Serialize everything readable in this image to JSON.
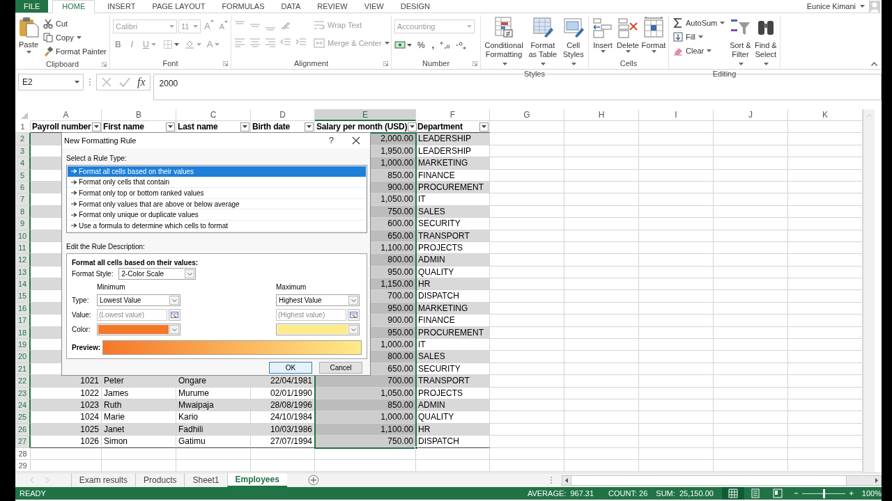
{
  "ribbon_tabs": [
    {
      "label": "FILE",
      "kind": "file",
      "selected": false
    },
    {
      "label": "HOME",
      "kind": "tab",
      "selected": true
    },
    {
      "label": "INSERT",
      "kind": "tab",
      "selected": false
    },
    {
      "label": "PAGE LAYOUT",
      "kind": "tab",
      "selected": false
    },
    {
      "label": "FORMULAS",
      "kind": "tab",
      "selected": false
    },
    {
      "label": "DATA",
      "kind": "tab",
      "selected": false
    },
    {
      "label": "REVIEW",
      "kind": "tab",
      "selected": false
    },
    {
      "label": "VIEW",
      "kind": "tab",
      "selected": false
    },
    {
      "label": "DESIGN",
      "kind": "tab",
      "selected": false
    }
  ],
  "user": {
    "name": "Eunice Kimani"
  },
  "ribbon": {
    "clipboard": {
      "label": "Clipboard",
      "paste": "Paste",
      "cut": "Cut",
      "copy": "Copy",
      "format_painter": "Format Painter"
    },
    "font": {
      "label": "Font",
      "disabled": true,
      "name": "Calibri",
      "size": "11",
      "grow": "A",
      "shrink": "A",
      "bold": "B",
      "italic": "I",
      "underline": "U",
      "font_color": "A"
    },
    "alignment": {
      "label": "Alignment",
      "disabled": true,
      "wrap_text": "Wrap Text",
      "merge_center": "Merge & Center"
    },
    "number": {
      "label": "Number",
      "format": "Accounting",
      "format_disabled": true,
      "percent": "%",
      "comma": ","
    },
    "styles": {
      "label": "Styles",
      "buttons": [
        "Conditional Formatting",
        "Format as Table",
        "Cell Styles"
      ]
    },
    "cells": {
      "label": "Cells",
      "buttons": [
        "Insert",
        "Delete",
        "Format"
      ]
    },
    "editing": {
      "label": "Editing",
      "autosum": "AutoSum",
      "fill": "Fill",
      "clear": "Clear",
      "sort_filter": "Sort & Filter",
      "find_select": "Find & Select"
    }
  },
  "formula_bar": {
    "name_box": "E2",
    "fx": "fx",
    "formula": "2000"
  },
  "table": {
    "columns": [
      {
        "letter": "A",
        "selected": false
      },
      {
        "letter": "B",
        "selected": false
      },
      {
        "letter": "C",
        "selected": false
      },
      {
        "letter": "D",
        "selected": false
      },
      {
        "letter": "E",
        "selected": true
      },
      {
        "letter": "F",
        "selected": false
      },
      {
        "letter": "G",
        "selected": false
      },
      {
        "letter": "H",
        "selected": false
      },
      {
        "letter": "I",
        "selected": false
      },
      {
        "letter": "J",
        "selected": false
      },
      {
        "letter": "K",
        "selected": false
      }
    ],
    "header_row": {
      "number": "1",
      "selected": false,
      "cells": [
        "Payroll number",
        "First name",
        "Last name",
        "Birth date",
        "Salary per month (USD)",
        "Department"
      ]
    },
    "rows": [
      {
        "number": "2",
        "selected": true,
        "salary": "2,000.00",
        "department": "LEADERSHIP"
      },
      {
        "number": "3",
        "selected": true,
        "salary": "1,950.00",
        "department": "LEADERSHIP"
      },
      {
        "number": "4",
        "selected": true,
        "salary": "1,000.00",
        "department": "MARKETING"
      },
      {
        "number": "5",
        "selected": true,
        "salary": "850.00",
        "department": "FINANCE"
      },
      {
        "number": "6",
        "selected": true,
        "salary": "900.00",
        "department": "PROCUREMENT"
      },
      {
        "number": "7",
        "selected": true,
        "salary": "1,050.00",
        "department": "IT"
      },
      {
        "number": "8",
        "selected": true,
        "salary": "750.00",
        "department": "SALES"
      },
      {
        "number": "9",
        "selected": true,
        "salary": "600.00",
        "department": "SECURITY"
      },
      {
        "number": "10",
        "selected": true,
        "salary": "650.00",
        "department": "TRANSPORT"
      },
      {
        "number": "11",
        "selected": true,
        "salary": "1,100.00",
        "department": "PROJECTS"
      },
      {
        "number": "12",
        "selected": true,
        "salary": "800.00",
        "department": "ADMIN"
      },
      {
        "number": "13",
        "selected": true,
        "salary": "950.00",
        "department": "QUALITY"
      },
      {
        "number": "14",
        "selected": true,
        "salary": "1,150.00",
        "department": "HR"
      },
      {
        "number": "15",
        "selected": true,
        "salary": "700.00",
        "department": "DISPATCH"
      },
      {
        "number": "16",
        "selected": true,
        "salary": "950.00",
        "department": "MARKETING"
      },
      {
        "number": "17",
        "selected": true,
        "salary": "900.00",
        "department": "FINANCE"
      },
      {
        "number": "18",
        "selected": true,
        "salary": "950.00",
        "department": "PROCUREMENT"
      },
      {
        "number": "19",
        "selected": true,
        "salary": "1,000.00",
        "department": "IT"
      },
      {
        "number": "20",
        "selected": true,
        "salary": "800.00",
        "department": "SALES"
      },
      {
        "number": "21",
        "selected": true,
        "salary": "650.00",
        "department": "SECURITY"
      },
      {
        "number": "22",
        "selected": true,
        "payroll": "1021",
        "first_name": "Peter",
        "last_name": "Ongare",
        "birth_date": "22/04/1981",
        "salary": "700.00",
        "department": "TRANSPORT"
      },
      {
        "number": "23",
        "selected": true,
        "payroll": "1022",
        "first_name": "James",
        "last_name": "Murume",
        "birth_date": "02/01/1990",
        "salary": "1,050.00",
        "department": "PROJECTS"
      },
      {
        "number": "24",
        "selected": true,
        "payroll": "1023",
        "first_name": "Ruth",
        "last_name": "Mwaipaja",
        "birth_date": "28/08/1996",
        "salary": "850.00",
        "department": "ADMIN"
      },
      {
        "number": "25",
        "selected": true,
        "payroll": "1024",
        "first_name": "Marie",
        "last_name": "Kario",
        "birth_date": "24/10/1984",
        "salary": "1,000.00",
        "department": "QUALITY"
      },
      {
        "number": "26",
        "selected": true,
        "payroll": "1025",
        "first_name": "Janet",
        "last_name": "Fadhili",
        "birth_date": "10/03/1986",
        "salary": "1,100.00",
        "department": "HR"
      },
      {
        "number": "27",
        "selected": true,
        "payroll": "1026",
        "first_name": "Simon",
        "last_name": "Gatimu",
        "birth_date": "27/07/1994",
        "salary": "750.00",
        "department": "DISPATCH"
      }
    ],
    "empty_rows": [
      {
        "number": "28",
        "selected": false
      },
      {
        "number": "29",
        "selected": false
      }
    ]
  },
  "sheet_tabs": [
    {
      "label": "Exam results",
      "selected": false
    },
    {
      "label": "Products",
      "selected": false
    },
    {
      "label": "Sheet1",
      "selected": false
    },
    {
      "label": "Employees",
      "selected": true
    }
  ],
  "status_bar": {
    "mode": "READY",
    "average": "AVERAGE:  967.31",
    "count": "COUNT: 26",
    "sum": "SUM:  25,150.00",
    "views": [
      {
        "kind": "normal",
        "selected": true
      },
      {
        "kind": "page_layout",
        "selected": false
      },
      {
        "kind": "page_break",
        "selected": false
      }
    ],
    "zoom": {
      "level": 0.5
    },
    "zoom_text": "100%"
  },
  "dialog": {
    "title": "New Formatting Rule",
    "help": "?",
    "select_label": "Select a Rule Type:",
    "rule_types": [
      {
        "label": "Format all cells based on their values",
        "selected": true
      },
      {
        "label": "Format only cells that contain",
        "selected": false
      },
      {
        "label": "Format only top or bottom ranked values",
        "selected": false
      },
      {
        "label": "Format only values that are above or below average",
        "selected": false
      },
      {
        "label": "Format only unique or duplicate values",
        "selected": false
      },
      {
        "label": "Use a formula to determine which cells to format",
        "selected": false
      }
    ],
    "edit_label": "Edit the Rule Description:",
    "description_heading": "Format all cells based on their values:",
    "format_style_label": "Format Style:",
    "format_style": "2-Color Scale",
    "type_label": "Type:",
    "value_label": "Value:",
    "color_label": "Color:",
    "minimum": {
      "label": "Minimum",
      "type": "Lowest Value",
      "placeholder": "(Lowest value)",
      "color": "#f5772a"
    },
    "maximum": {
      "label": "Maximum",
      "type": "Highest Value",
      "placeholder": "(Highest value)",
      "color": "#ffea8a"
    },
    "preview_label": "Preview:",
    "ok": "OK",
    "cancel": "Cancel"
  }
}
